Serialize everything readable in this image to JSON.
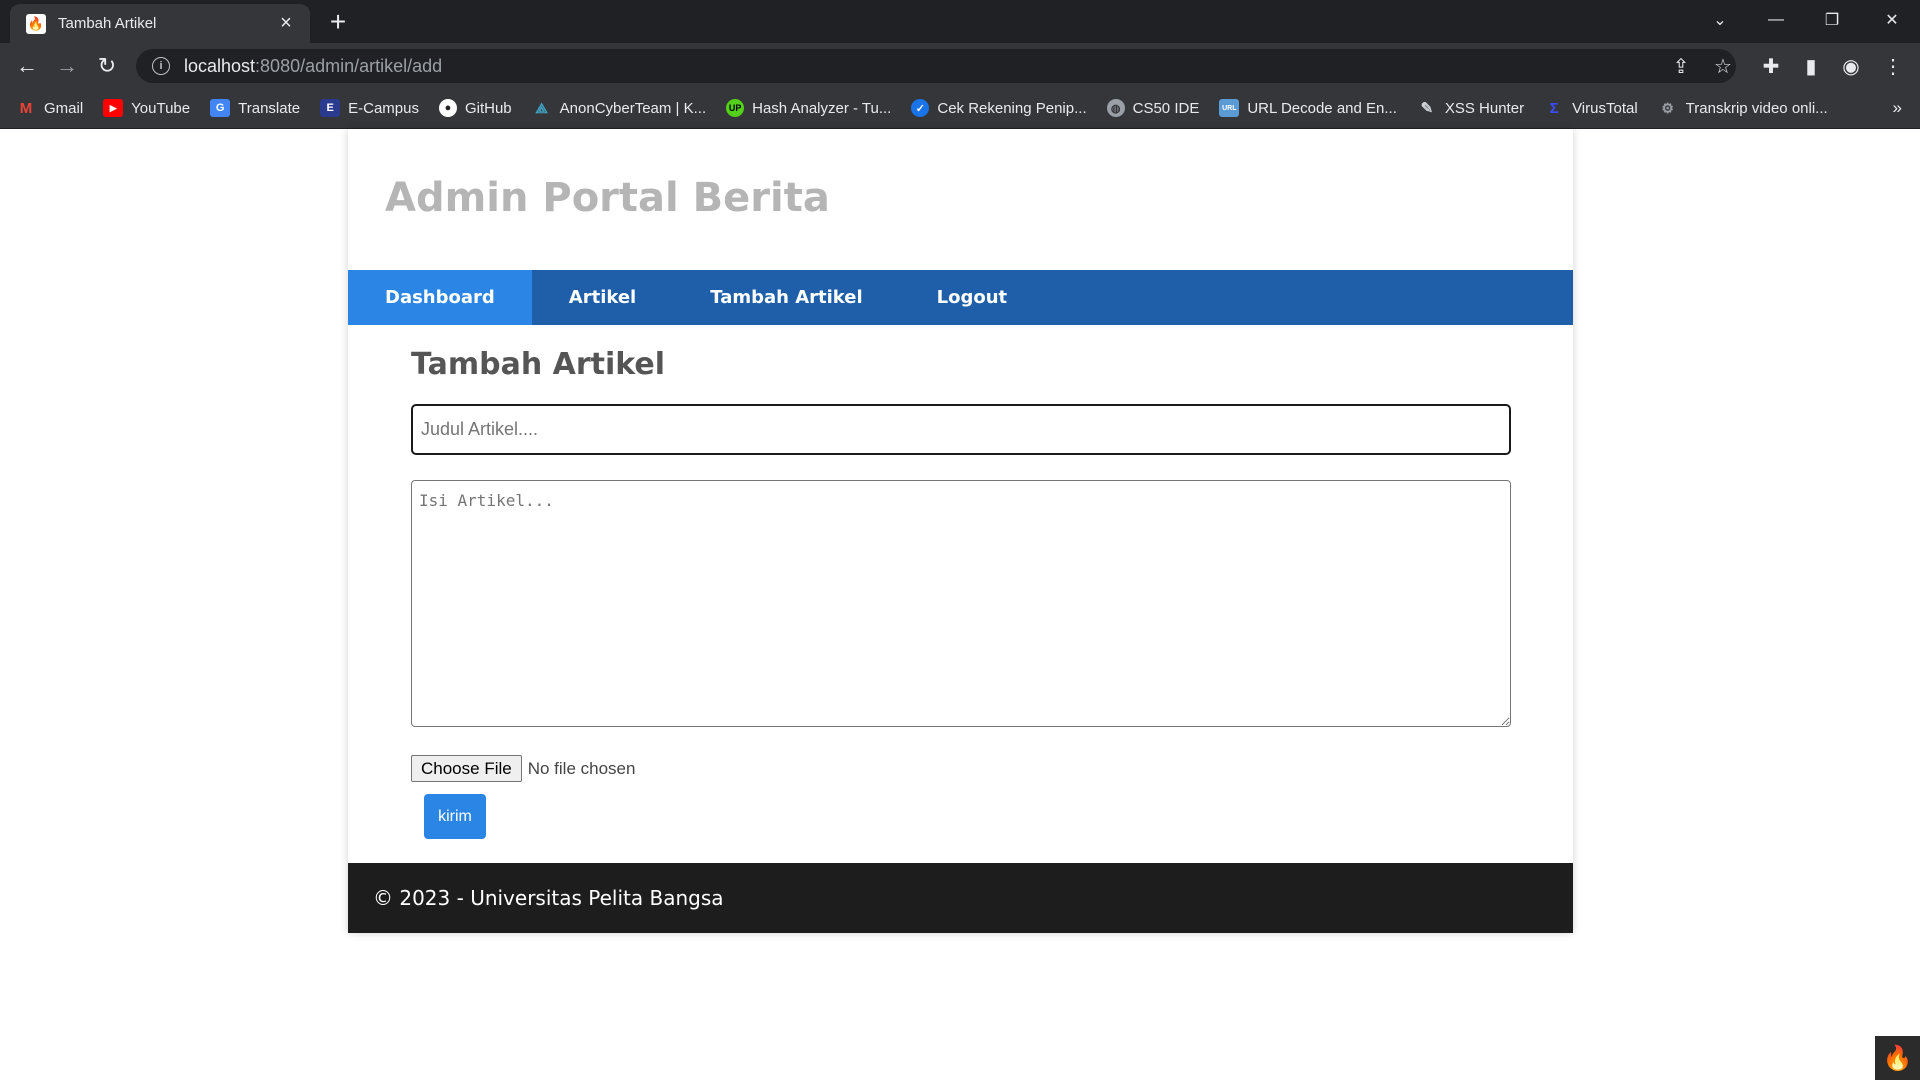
{
  "browser": {
    "tab_title": "Tambah Artikel",
    "tab_favicon": "flame-icon",
    "url_host": "localhost",
    "url_rest": ":8080/admin/artikel/add",
    "bookmarks": [
      {
        "label": "Gmail",
        "icon": "gmail-icon",
        "color": "#ea4335"
      },
      {
        "label": "YouTube",
        "icon": "youtube-icon",
        "color": "#ff0000"
      },
      {
        "label": "Translate",
        "icon": "translate-icon",
        "color": "#4285f4"
      },
      {
        "label": "E-Campus",
        "icon": "ecampus-icon",
        "color": "#2a3b8f"
      },
      {
        "label": "GitHub",
        "icon": "github-icon",
        "color": "#ffffff"
      },
      {
        "label": "AnonCyberTeam | K...",
        "icon": "anoncyberteam-icon",
        "color": "#3fa7c9"
      },
      {
        "label": "Hash Analyzer - Tu...",
        "icon": "hash-analyzer-icon",
        "color": "#53d01a"
      },
      {
        "label": "Cek Rekening Penip...",
        "icon": "check-badge-icon",
        "color": "#1a73e8"
      },
      {
        "label": "CS50 IDE",
        "icon": "globe-icon",
        "color": "#9aa0a6"
      },
      {
        "label": "URL Decode and En...",
        "icon": "url-icon",
        "color": "#5b9bd5"
      },
      {
        "label": "XSS Hunter",
        "icon": "pen-icon",
        "color": "#9aa0a6"
      },
      {
        "label": "VirusTotal",
        "icon": "virustotal-icon",
        "color": "#394eff"
      },
      {
        "label": "Transkrip video onli...",
        "icon": "gear-icon",
        "color": "#9aa0a6"
      }
    ]
  },
  "site": {
    "title": "Admin Portal Berita",
    "nav": [
      {
        "label": "Dashboard",
        "active": true
      },
      {
        "label": "Artikel",
        "active": false
      },
      {
        "label": "Tambah Artikel",
        "active": false
      },
      {
        "label": "Logout",
        "active": false
      }
    ],
    "page_title": "Tambah Artikel",
    "form": {
      "title_placeholder": "Judul Artikel....",
      "body_placeholder": "Isi Artikel...",
      "file_button": "Choose File",
      "file_status": "No file chosen",
      "submit_label": "kirim"
    },
    "footer": "© 2023 - Universitas Pelita Bangsa"
  },
  "colors": {
    "nav_bg": "#1f5fa9",
    "nav_active": "#2b85e4",
    "footer_bg": "#1d1d1d",
    "title_gray": "#b5b5b5"
  }
}
